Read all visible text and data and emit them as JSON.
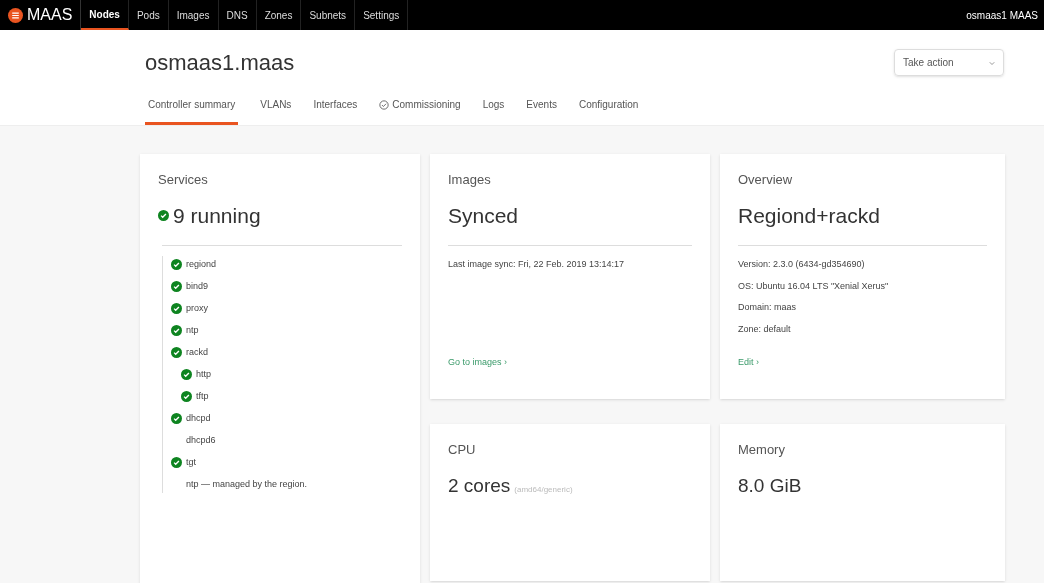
{
  "navbar": {
    "brand": "MAAS",
    "items": [
      {
        "label": "Nodes",
        "selected": true
      },
      {
        "label": "Pods",
        "selected": false
      },
      {
        "label": "Images",
        "selected": false
      },
      {
        "label": "DNS",
        "selected": false
      },
      {
        "label": "Zones",
        "selected": false
      },
      {
        "label": "Subnets",
        "selected": false
      },
      {
        "label": "Settings",
        "selected": false
      }
    ],
    "user": "osmaas1 MAAS"
  },
  "header": {
    "title": "osmaas1.maas",
    "action": "Take action",
    "tabs": [
      {
        "label": "Controller summary",
        "selected": true,
        "passed": false
      },
      {
        "label": "VLANs",
        "selected": false,
        "passed": false
      },
      {
        "label": "Interfaces",
        "selected": false,
        "passed": false
      },
      {
        "label": "Commissioning",
        "selected": false,
        "passed": true
      },
      {
        "label": "Logs",
        "selected": false,
        "passed": false
      },
      {
        "label": "Events",
        "selected": false,
        "passed": false
      },
      {
        "label": "Configuration",
        "selected": false,
        "passed": false
      }
    ]
  },
  "services": {
    "title": "Services",
    "summary": "9 running",
    "items": [
      {
        "name": "regiond",
        "running": true
      },
      {
        "name": "bind9",
        "running": true
      },
      {
        "name": "proxy",
        "running": true
      },
      {
        "name": "ntp",
        "running": true
      },
      {
        "name": "rackd",
        "running": true,
        "children": [
          {
            "name": "http",
            "running": true
          },
          {
            "name": "tftp",
            "running": true
          }
        ]
      },
      {
        "name": "dhcpd",
        "running": true
      },
      {
        "name": "dhcpd6",
        "running": false
      },
      {
        "name": "tgt",
        "running": true
      }
    ],
    "note": "ntp — managed by the region."
  },
  "images": {
    "title": "Images",
    "status": "Synced",
    "details": [
      "Last image sync: Fri, 22 Feb. 2019 13:14:17"
    ],
    "link": "Go to images ›"
  },
  "overview": {
    "title": "Overview",
    "status": "Regiond+rackd",
    "details": [
      "Version: 2.3.0 (6434-gd354690)",
      "OS: Ubuntu 16.04 LTS \"Xenial Xerus\"",
      "Domain: maas",
      "Zone: default"
    ],
    "link": "Edit ›"
  },
  "cpu": {
    "title": "CPU",
    "value": "2 cores",
    "sub": "(amd64/generic)"
  },
  "memory": {
    "title": "Memory",
    "value": "8.0 GiB"
  }
}
